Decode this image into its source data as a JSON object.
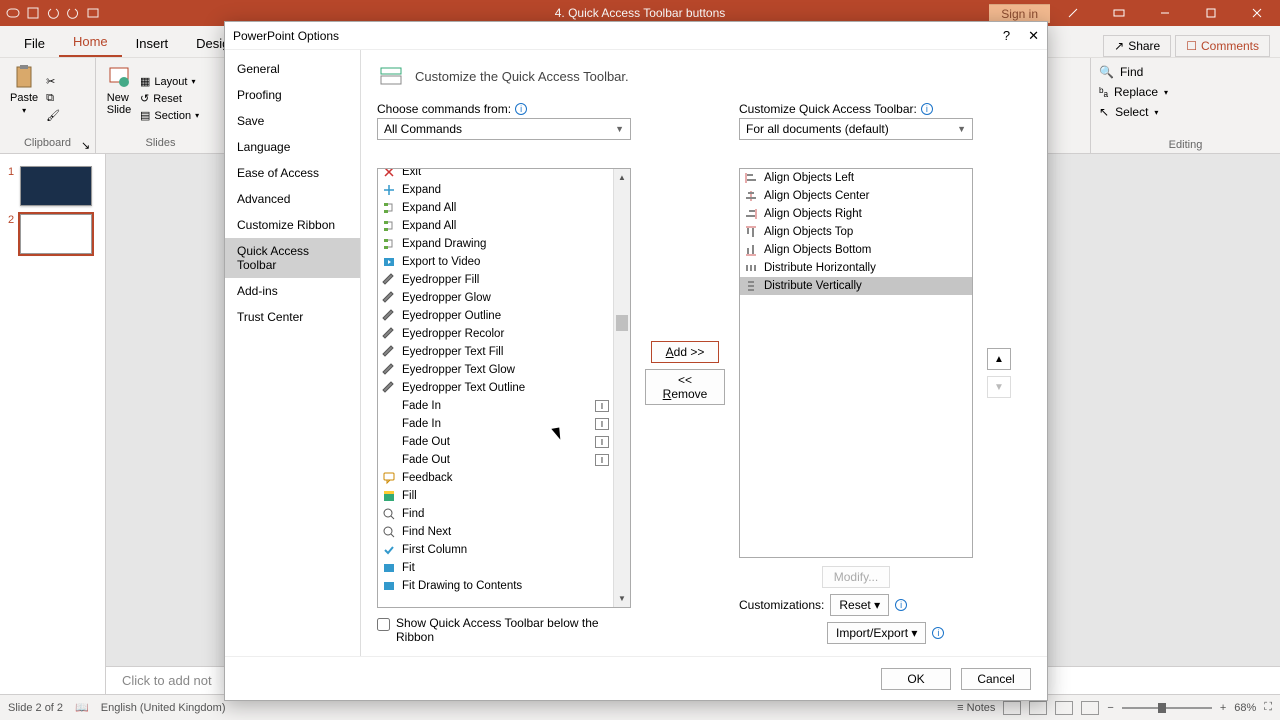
{
  "title": "4. Quick Access Toolbar buttons",
  "signin": "Sign in",
  "menu": [
    "File",
    "Home",
    "Insert",
    "Design"
  ],
  "menu_active": 1,
  "share": "Share",
  "comments": "Comments",
  "ribbon": {
    "clipboard_label": "Clipboard",
    "paste": "Paste",
    "slides_label": "Slides",
    "new_slide": "New\nSlide",
    "layout": "Layout",
    "reset": "Reset",
    "section": "Section",
    "editing_label": "Editing",
    "find": "Find",
    "replace": "Replace",
    "select": "Select"
  },
  "thumbs": [
    {
      "n": "1",
      "dark": true
    },
    {
      "n": "2",
      "sel": true
    }
  ],
  "notes_placeholder": "Click to add not",
  "status": {
    "left": "Slide 2 of 2",
    "lang": "English (United Kingdom)",
    "notes": "Notes",
    "zoom": "68%"
  },
  "dialog": {
    "title": "PowerPoint Options",
    "nav": [
      "General",
      "Proofing",
      "Save",
      "Language",
      "Ease of Access",
      "Advanced",
      "Customize Ribbon",
      "Quick Access Toolbar",
      "Add-ins",
      "Trust Center"
    ],
    "nav_sel": 7,
    "header": "Customize the Quick Access Toolbar.",
    "choose_label": "Choose commands from:",
    "choose_value": "All Commands",
    "customize_label": "Customize Quick Access Toolbar:",
    "customize_value": "For all documents (default)",
    "left_items": [
      {
        "icon": "x",
        "label": "Exit"
      },
      {
        "icon": "plus",
        "label": "Expand"
      },
      {
        "icon": "tree",
        "label": "Expand All"
      },
      {
        "icon": "tree",
        "label": "Expand All"
      },
      {
        "icon": "tree",
        "label": "Expand Drawing"
      },
      {
        "icon": "video",
        "label": "Export to Video"
      },
      {
        "icon": "pen",
        "label": "Eyedropper Fill"
      },
      {
        "icon": "pen",
        "label": "Eyedropper Glow"
      },
      {
        "icon": "pen",
        "label": "Eyedropper Outline"
      },
      {
        "icon": "pen",
        "label": "Eyedropper Recolor"
      },
      {
        "icon": "pen",
        "label": "Eyedropper Text Fill"
      },
      {
        "icon": "pen",
        "label": "Eyedropper Text Glow"
      },
      {
        "icon": "pen",
        "label": "Eyedropper Text Outline"
      },
      {
        "icon": "",
        "label": "Fade In",
        "r": "I"
      },
      {
        "icon": "",
        "label": "Fade In",
        "r": "I"
      },
      {
        "icon": "",
        "label": "Fade Out",
        "r": "I"
      },
      {
        "icon": "",
        "label": "Fade Out",
        "r": "I"
      },
      {
        "icon": "chat",
        "label": "Feedback"
      },
      {
        "icon": "fill",
        "label": "Fill"
      },
      {
        "icon": "find",
        "label": "Find"
      },
      {
        "icon": "find",
        "label": "Find Next"
      },
      {
        "icon": "check",
        "label": "First Column"
      },
      {
        "icon": "fit",
        "label": "Fit"
      },
      {
        "icon": "fit",
        "label": "Fit Drawing to Contents"
      }
    ],
    "right_items": [
      {
        "icon": "al",
        "label": "Align Objects Left"
      },
      {
        "icon": "ac",
        "label": "Align Objects Center"
      },
      {
        "icon": "ar",
        "label": "Align Objects Right"
      },
      {
        "icon": "at",
        "label": "Align Objects Top"
      },
      {
        "icon": "ab",
        "label": "Align Objects Bottom"
      },
      {
        "icon": "dh",
        "label": "Distribute Horizontally"
      },
      {
        "icon": "dv",
        "label": "Distribute Vertically",
        "sel": true
      }
    ],
    "add": "Add >>",
    "remove": "<< Remove",
    "modify": "Modify...",
    "customizations": "Customizations:",
    "reset": "Reset",
    "import_export": "Import/Export",
    "show_below": "Show Quick Access Toolbar below the Ribbon",
    "ok": "OK",
    "cancel": "Cancel"
  }
}
